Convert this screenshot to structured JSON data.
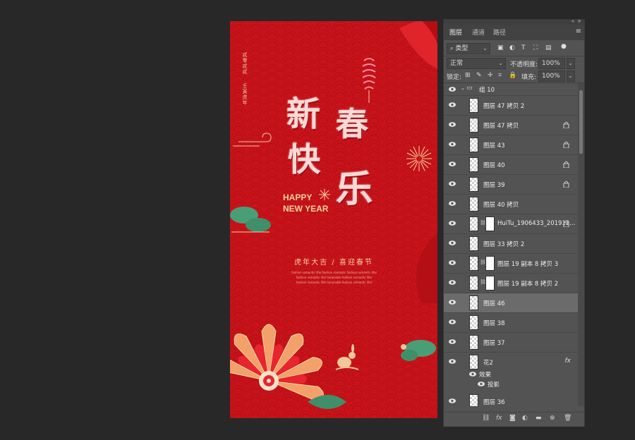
{
  "poster": {
    "vertical_text_1": "贰零贰贰",
    "vertical_text_2": "壬寅虎年",
    "title_chars": [
      "新",
      "春",
      "快",
      "乐"
    ],
    "happy_line1": "HAPPY",
    "happy_line2": "NEW YEAR",
    "slogan": "虎年大吉 / 喜迎春节",
    "fine_print_1": "fashion romantic life/ fashion romantic fashion romantic life/",
    "fine_print_2": "fashion romantic life/ honorable fashion romantic life/",
    "fine_print_3": "fashion romantic life/ honorable fashion romantic life/",
    "colors": {
      "background": "#c8131a",
      "gold": "#f7d29c",
      "green": "#3e8f6a"
    }
  },
  "panel": {
    "tabs": [
      "图层",
      "通道",
      "路径"
    ],
    "active_tab": "图层",
    "filter_kind": "类型",
    "blend_mode": "正常",
    "opacity_label": "不透明度:",
    "opacity_value": "100%",
    "lock_label": "锁定:",
    "fill_label": "填充:",
    "fill_value": "100%",
    "group_name": "组 10",
    "layers": [
      {
        "name": "图层 47 拷贝 2",
        "locked": false
      },
      {
        "name": "图层 47 拷贝",
        "locked": true
      },
      {
        "name": "图层 43",
        "locked": true
      },
      {
        "name": "图层 40",
        "locked": true
      },
      {
        "name": "图层 39",
        "locked": true
      },
      {
        "name": "图层 40 拷贝",
        "locked": false
      },
      {
        "name": "HuiTu_1906433_201912...",
        "locked": true
      },
      {
        "name": "图层 33 拷贝 2",
        "locked": false
      },
      {
        "name": "图层 19 副本 8 拷贝 3",
        "locked": false
      },
      {
        "name": "图层 19 副本 8 拷贝 2",
        "locked": false
      },
      {
        "name": "图层 46",
        "locked": false,
        "selected": true
      },
      {
        "name": "图层 38",
        "locked": false
      },
      {
        "name": "图层 37",
        "locked": false
      },
      {
        "name": "花2",
        "locked": false,
        "fx": "fx"
      },
      {
        "name": "图层 36",
        "locked": false
      }
    ],
    "effects_label": "效果",
    "drop_shadow_label": "投影"
  }
}
